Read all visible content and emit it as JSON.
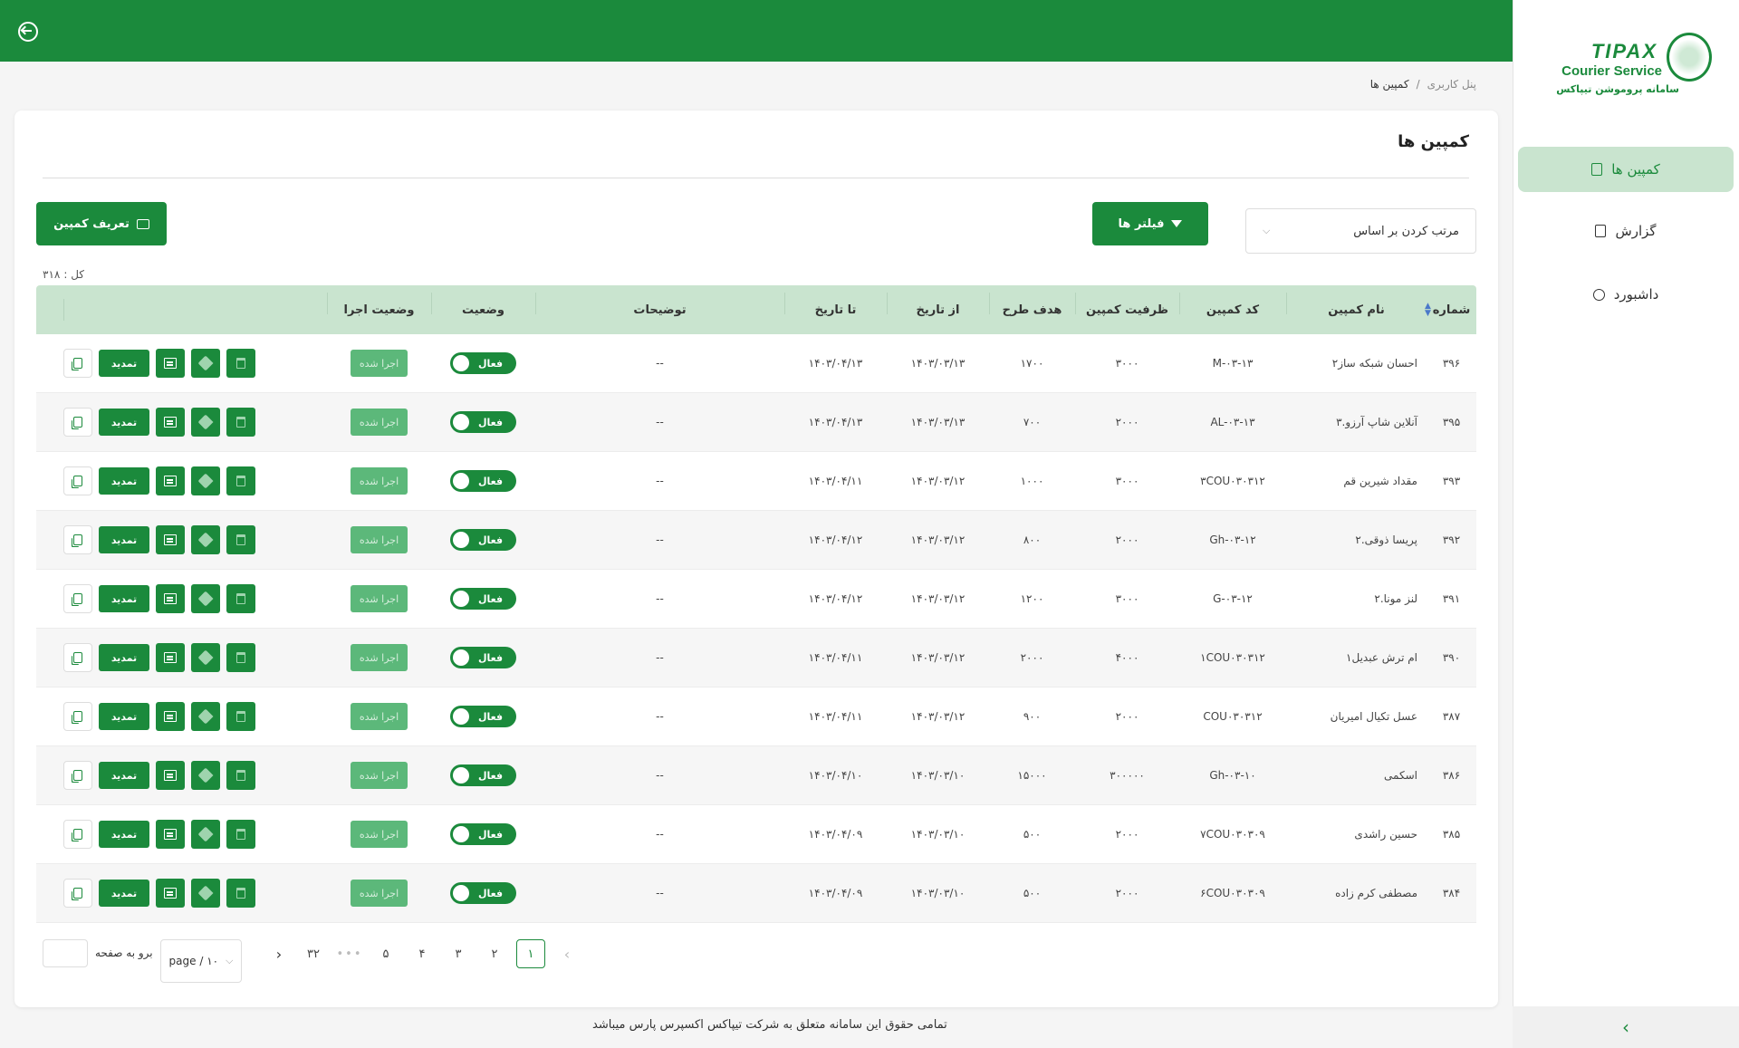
{
  "header": {
    "logout_icon": "logout-icon"
  },
  "sidebar": {
    "logo": {
      "brand": "TIPAX",
      "tagline": "Courier Service",
      "subtitle": "سامانه پروموشن تیپاکس"
    },
    "items": [
      {
        "label": "کمپین ها",
        "icon": "bookmark-icon",
        "active": true
      },
      {
        "label": "گزارش",
        "icon": "report-icon",
        "active": false
      },
      {
        "label": "داشبورد",
        "icon": "dashboard-icon",
        "active": false
      }
    ],
    "collapse_glyph": "‹"
  },
  "breadcrumb": {
    "root": "پنل کاربری",
    "separator": "/",
    "current": "کمپین ها"
  },
  "page": {
    "title": "کمپین ها",
    "define_button": "تعریف کمپین",
    "filter_button": "فیلتر ها",
    "sort_placeholder": "مرتب کردن بر اساس",
    "total_label": "کل :",
    "total_value": "۳۱۸"
  },
  "table": {
    "headers": {
      "num": "شماره",
      "name": "نام کمپین",
      "code": "کد کمپین",
      "capacity": "ظرفیت کمپین",
      "goal": "هدف طرح",
      "from": "از تاریخ",
      "to": "تا تاریخ",
      "desc": "توضیحات",
      "status": "وضعیت",
      "run_status": "وضعیت اجرا"
    },
    "status_label": "فعال",
    "run_label": "اجرا شده",
    "renew_label": "تمدید",
    "rows": [
      {
        "num": "۳۹۶",
        "name": "احسان شبکه ساز۲",
        "code": "M-۰۳-۱۳",
        "capacity": "۳۰۰۰",
        "goal": "۱۷۰۰",
        "from": "۱۴۰۳/۰۳/۱۳",
        "to": "۱۴۰۳/۰۴/۱۳",
        "desc": "--"
      },
      {
        "num": "۳۹۵",
        "name": "آنلاین شاپ آرزو.۳",
        "code": "AL-۰۳-۱۳",
        "capacity": "۲۰۰۰",
        "goal": "۷۰۰",
        "from": "۱۴۰۳/۰۳/۱۳",
        "to": "۱۴۰۳/۰۴/۱۳",
        "desc": "--"
      },
      {
        "num": "۳۹۳",
        "name": "مقداد شیرین قم",
        "code": "۳COU۰۳۰۳۱۲",
        "capacity": "۳۰۰۰",
        "goal": "۱۰۰۰",
        "from": "۱۴۰۳/۰۳/۱۲",
        "to": "۱۴۰۳/۰۴/۱۱",
        "desc": "--"
      },
      {
        "num": "۳۹۲",
        "name": "پریسا ذوقی.۲",
        "code": "Gh-۰۳-۱۲",
        "capacity": "۲۰۰۰",
        "goal": "۸۰۰",
        "from": "۱۴۰۳/۰۳/۱۲",
        "to": "۱۴۰۳/۰۴/۱۲",
        "desc": "--"
      },
      {
        "num": "۳۹۱",
        "name": "لنز مونا.۲",
        "code": "G-۰۳-۱۲",
        "capacity": "۳۰۰۰",
        "goal": "۱۲۰۰",
        "from": "۱۴۰۳/۰۳/۱۲",
        "to": "۱۴۰۳/۰۴/۱۲",
        "desc": "--"
      },
      {
        "num": "۳۹۰",
        "name": "ام ترش عبدیل۱",
        "code": "۱COU۰۳۰۳۱۲",
        "capacity": "۴۰۰۰",
        "goal": "۲۰۰۰",
        "from": "۱۴۰۳/۰۳/۱۲",
        "to": "۱۴۰۳/۰۴/۱۱",
        "desc": "--"
      },
      {
        "num": "۳۸۷",
        "name": "عسل تکیال امیریان",
        "code": "COU۰۳۰۳۱۲",
        "capacity": "۲۰۰۰",
        "goal": "۹۰۰",
        "from": "۱۴۰۳/۰۳/۱۲",
        "to": "۱۴۰۳/۰۴/۱۱",
        "desc": "--"
      },
      {
        "num": "۳۸۶",
        "name": "اسکمی",
        "code": "Gh-۰۳-۱۰",
        "capacity": "۳۰۰۰۰۰",
        "goal": "۱۵۰۰۰",
        "from": "۱۴۰۳/۰۳/۱۰",
        "to": "۱۴۰۳/۰۴/۱۰",
        "desc": "--"
      },
      {
        "num": "۳۸۵",
        "name": "حسین راشدی",
        "code": "۷COU۰۳۰۳۰۹",
        "capacity": "۲۰۰۰",
        "goal": "۵۰۰",
        "from": "۱۴۰۳/۰۳/۱۰",
        "to": "۱۴۰۳/۰۴/۰۹",
        "desc": "--"
      },
      {
        "num": "۳۸۴",
        "name": "مصطفی کرم زاده",
        "code": "۶COU۰۳۰۳۰۹",
        "capacity": "۲۰۰۰",
        "goal": "۵۰۰",
        "from": "۱۴۰۳/۰۳/۱۰",
        "to": "۱۴۰۳/۰۴/۰۹",
        "desc": "--"
      }
    ]
  },
  "pagination": {
    "pages": [
      "۱",
      "۲",
      "۳",
      "۴",
      "۵"
    ],
    "dots": "•••",
    "last": "۳۲",
    "prev_glyph": "‹",
    "next_glyph": "›",
    "page_size": "page / ۱۰",
    "goto_label": "برو به صفحه",
    "goto_value": ""
  },
  "footer": {
    "copyright": "تمامی حقوق این سامانه متعلق به شرکت تیپاکس اکسپرس پارس میباشد"
  },
  "colors": {
    "primary": "#1b8a3c",
    "header_bg": "#c9e4cf",
    "run_badge": "#5cb87a"
  }
}
